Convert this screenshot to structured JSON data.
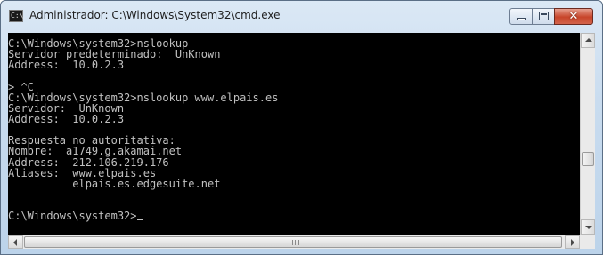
{
  "window": {
    "title": "Administrador: C:\\Windows\\System32\\cmd.exe",
    "icon": "cmd-icon",
    "icon_text": "C:\\"
  },
  "controls": {
    "minimize": "minimize-icon",
    "maximize": "maximize-icon",
    "close": "close-icon",
    "close_glyph": "✕"
  },
  "console": {
    "lines": [
      "C:\\Windows\\system32>nslookup",
      "Servidor predeterminado:  UnKnown",
      "Address:  10.0.2.3",
      "",
      "> ^C",
      "C:\\Windows\\system32>nslookup www.elpais.es",
      "Servidor:  UnKnown",
      "Address:  10.0.2.3",
      "",
      "Respuesta no autoritativa:",
      "Nombre:  a1749.g.akamai.net",
      "Address:  212.106.219.176",
      "Aliases:  www.elpais.es",
      "          elpais.es.edgesuite.net",
      "",
      "",
      "C:\\Windows\\system32>"
    ]
  },
  "colors": {
    "console_bg": "#000000",
    "console_fg": "#c0c0c0",
    "close_button": "#c7452a"
  }
}
